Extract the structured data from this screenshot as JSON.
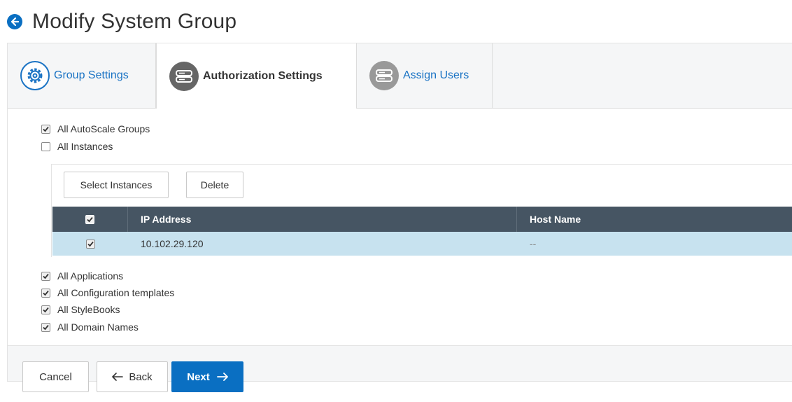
{
  "page": {
    "title": "Modify System Group"
  },
  "tabs": [
    {
      "label": "Group Settings",
      "icon": "gear-icon",
      "active": false
    },
    {
      "label": "Authorization Settings",
      "icon": "server-icon",
      "active": true
    },
    {
      "label": "Assign Users",
      "icon": "server-icon",
      "active": false
    }
  ],
  "checks": {
    "autoscale": {
      "label": "All AutoScale Groups",
      "checked": true
    },
    "instances": {
      "label": "All Instances",
      "checked": false
    },
    "applications": {
      "label": "All Applications",
      "checked": true
    },
    "config_templates": {
      "label": "All Configuration templates",
      "checked": true
    },
    "stylebooks": {
      "label": "All StyleBooks",
      "checked": true
    },
    "domain_names": {
      "label": "All Domain Names",
      "checked": true
    }
  },
  "instances_panel": {
    "select_label": "Select Instances",
    "delete_label": "Delete",
    "columns": [
      "IP Address",
      "Host Name"
    ],
    "rows": [
      {
        "ip": "10.102.29.120",
        "host": "--",
        "checked": true
      }
    ]
  },
  "footer": {
    "cancel_label": "Cancel",
    "back_label": "Back",
    "next_label": "Next"
  },
  "colors": {
    "accent": "#0a6fc2",
    "grid_header": "#465563",
    "selected_row": "#c7e2ef"
  }
}
